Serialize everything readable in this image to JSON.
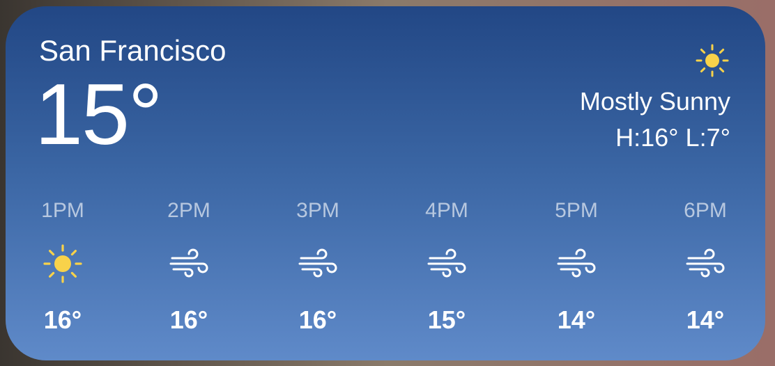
{
  "widget": {
    "city": "San Francisco",
    "temperature": "15°",
    "condition": "Mostly Sunny",
    "hi_lo": "H:16° L:7°",
    "condition_icon": "sun-icon",
    "colors": {
      "background_top": "#224785",
      "background_bottom": "#5f8ac9",
      "sun": "#f8d24a",
      "text": "#ffffff"
    }
  },
  "hourly": [
    {
      "time": "1PM",
      "icon": "sun-icon",
      "temp": "16°"
    },
    {
      "time": "2PM",
      "icon": "wind-icon",
      "temp": "16°"
    },
    {
      "time": "3PM",
      "icon": "wind-icon",
      "temp": "16°"
    },
    {
      "time": "4PM",
      "icon": "wind-icon",
      "temp": "15°"
    },
    {
      "time": "5PM",
      "icon": "wind-icon",
      "temp": "14°"
    },
    {
      "time": "6PM",
      "icon": "wind-icon",
      "temp": "14°"
    }
  ]
}
